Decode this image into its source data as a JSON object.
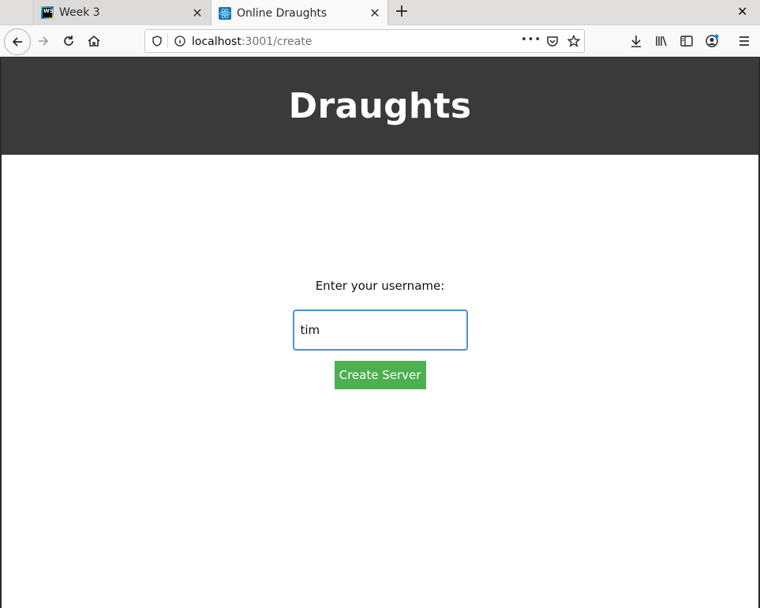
{
  "browser": {
    "tabs": [
      {
        "title": "Week 3",
        "icon": "webstorm-icon"
      },
      {
        "title": "Online Draughts",
        "icon": "react-icon",
        "active": true
      }
    ],
    "new_tab_label": "+",
    "window_close_label": "✕",
    "tab_close_label": "✕",
    "url": {
      "host": "localhost",
      "rest": ":3001/create"
    },
    "overflow_label": "•••"
  },
  "page": {
    "header_title": "Draughts",
    "form": {
      "label": "Enter your username:",
      "username_value": "tim",
      "submit_label": "Create Server"
    }
  },
  "colors": {
    "header_bg": "#3a3a3a",
    "button_bg": "#4caf50",
    "input_border": "#4a90d9"
  }
}
